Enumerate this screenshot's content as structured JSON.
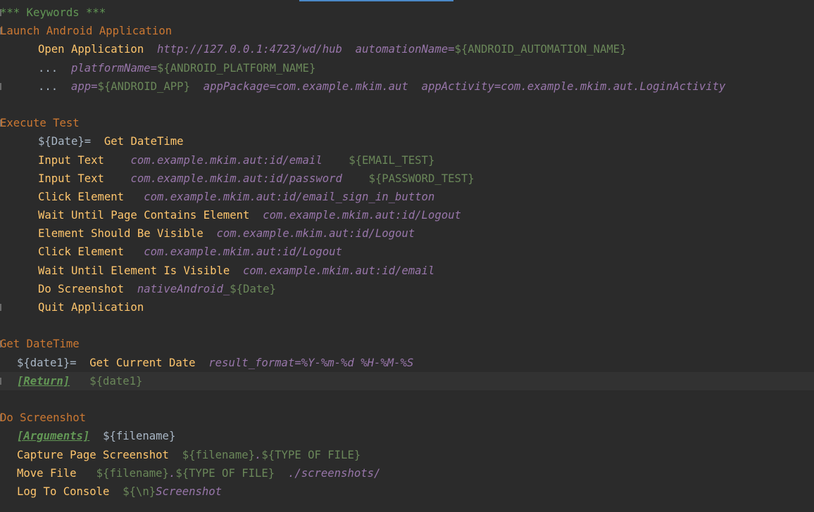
{
  "editor": {
    "lines": [
      {
        "indent": 0,
        "fold": true,
        "tokens": [
          {
            "c": "hdr",
            "t": "*** Keywords ***"
          }
        ]
      },
      {
        "indent": 0,
        "fold": true,
        "tokens": [
          {
            "c": "kwname",
            "t": "Launch Android Application"
          }
        ]
      },
      {
        "indent": 54,
        "fold": false,
        "tokens": [
          {
            "c": "kw",
            "t": "Open Application"
          },
          {
            "c": "gap",
            "t": "  "
          },
          {
            "c": "arg",
            "t": "http://127.0.0.1:4723/wd/hub"
          },
          {
            "c": "gap",
            "t": "  "
          },
          {
            "c": "arg",
            "t": "automationName="
          },
          {
            "c": "varg",
            "t": "${ANDROID_AUTOMATION_NAME}"
          }
        ]
      },
      {
        "indent": 54,
        "fold": false,
        "tokens": [
          {
            "c": "plain",
            "t": "..."
          },
          {
            "c": "gap",
            "t": "  "
          },
          {
            "c": "arg",
            "t": "platformName="
          },
          {
            "c": "varg",
            "t": "${ANDROID_PLATFORM_NAME}"
          }
        ]
      },
      {
        "indent": 54,
        "fold": true,
        "tokens": [
          {
            "c": "plain",
            "t": "..."
          },
          {
            "c": "gap",
            "t": "  "
          },
          {
            "c": "arg",
            "t": "app="
          },
          {
            "c": "varg",
            "t": "${ANDROID_APP}"
          },
          {
            "c": "gap",
            "t": "  "
          },
          {
            "c": "arg",
            "t": "appPackage=com.example.mkim.aut"
          },
          {
            "c": "gap",
            "t": "  "
          },
          {
            "c": "arg",
            "t": "appActivity=com.example.mkim.aut.LoginActivity"
          }
        ]
      },
      {
        "indent": 0,
        "fold": false,
        "tokens": []
      },
      {
        "indent": 0,
        "fold": true,
        "tokens": [
          {
            "c": "kwname",
            "t": "Execute Test"
          }
        ]
      },
      {
        "indent": 54,
        "fold": false,
        "tokens": [
          {
            "c": "var",
            "t": "${Date}="
          },
          {
            "c": "gap",
            "t": "  "
          },
          {
            "c": "kw",
            "t": "Get DateTime"
          }
        ]
      },
      {
        "indent": 54,
        "fold": false,
        "tokens": [
          {
            "c": "kw",
            "t": "Input Text"
          },
          {
            "c": "gap",
            "t": "    "
          },
          {
            "c": "arg",
            "t": "com.example.mkim.aut:id/email"
          },
          {
            "c": "gap",
            "t": "    "
          },
          {
            "c": "varg",
            "t": "${EMAIL_TEST}"
          }
        ]
      },
      {
        "indent": 54,
        "fold": false,
        "tokens": [
          {
            "c": "kw",
            "t": "Input Text"
          },
          {
            "c": "gap",
            "t": "    "
          },
          {
            "c": "arg",
            "t": "com.example.mkim.aut:id/password"
          },
          {
            "c": "gap",
            "t": "    "
          },
          {
            "c": "varg",
            "t": "${PASSWORD_TEST}"
          }
        ]
      },
      {
        "indent": 54,
        "fold": false,
        "tokens": [
          {
            "c": "kw",
            "t": "Click Element"
          },
          {
            "c": "gap",
            "t": "   "
          },
          {
            "c": "arg",
            "t": "com.example.mkim.aut:id/email_sign_in_button"
          }
        ]
      },
      {
        "indent": 54,
        "fold": false,
        "tokens": [
          {
            "c": "kw",
            "t": "Wait Until Page Contains Element"
          },
          {
            "c": "gap",
            "t": "  "
          },
          {
            "c": "arg",
            "t": "com.example.mkim.aut:id/Logout"
          }
        ]
      },
      {
        "indent": 54,
        "fold": false,
        "tokens": [
          {
            "c": "kw",
            "t": "Element Should Be Visible"
          },
          {
            "c": "gap",
            "t": "  "
          },
          {
            "c": "arg",
            "t": "com.example.mkim.aut:id/Logout"
          }
        ]
      },
      {
        "indent": 54,
        "fold": false,
        "tokens": [
          {
            "c": "kw",
            "t": "Click Element"
          },
          {
            "c": "gap",
            "t": "   "
          },
          {
            "c": "arg",
            "t": "com.example.mkim.aut:id/Logout"
          }
        ]
      },
      {
        "indent": 54,
        "fold": false,
        "tokens": [
          {
            "c": "kw",
            "t": "Wait Until Element Is Visible"
          },
          {
            "c": "gap",
            "t": "  "
          },
          {
            "c": "arg",
            "t": "com.example.mkim.aut:id/email"
          }
        ]
      },
      {
        "indent": 54,
        "fold": false,
        "tokens": [
          {
            "c": "kw",
            "t": "Do Screenshot"
          },
          {
            "c": "gap",
            "t": "  "
          },
          {
            "c": "arg",
            "t": "nativeAndroid_"
          },
          {
            "c": "varg",
            "t": "${Date}"
          }
        ]
      },
      {
        "indent": 54,
        "fold": true,
        "tokens": [
          {
            "c": "kw",
            "t": "Quit Application"
          }
        ]
      },
      {
        "indent": 0,
        "fold": false,
        "tokens": []
      },
      {
        "indent": 0,
        "fold": true,
        "tokens": [
          {
            "c": "kwname",
            "t": "Get DateTime"
          }
        ]
      },
      {
        "indent": 24,
        "fold": false,
        "tokens": [
          {
            "c": "var",
            "t": "${date1}="
          },
          {
            "c": "gap",
            "t": "  "
          },
          {
            "c": "kw",
            "t": "Get Current Date"
          },
          {
            "c": "gap",
            "t": "  "
          },
          {
            "c": "arg",
            "t": "result_format=%Y-%m-%d %H-%M-%S"
          }
        ]
      },
      {
        "indent": 24,
        "fold": true,
        "current": true,
        "tokens": [
          {
            "c": "setting",
            "t": "[Return]"
          },
          {
            "c": "gap",
            "t": "   "
          },
          {
            "c": "varg",
            "t": "${date1}"
          }
        ]
      },
      {
        "indent": 0,
        "fold": false,
        "tokens": []
      },
      {
        "indent": 0,
        "fold": true,
        "tokens": [
          {
            "c": "kwname",
            "t": "Do Screenshot"
          }
        ]
      },
      {
        "indent": 24,
        "fold": false,
        "tokens": [
          {
            "c": "setting",
            "t": "[Arguments]"
          },
          {
            "c": "gap",
            "t": "  "
          },
          {
            "c": "var",
            "t": "${filename}"
          }
        ]
      },
      {
        "indent": 24,
        "fold": false,
        "tokens": [
          {
            "c": "kw",
            "t": "Capture Page Screenshot"
          },
          {
            "c": "gap",
            "t": "  "
          },
          {
            "c": "varg",
            "t": "${filename}"
          },
          {
            "c": "arg",
            "t": "."
          },
          {
            "c": "varg",
            "t": "${TYPE OF FILE}"
          }
        ]
      },
      {
        "indent": 24,
        "fold": false,
        "tokens": [
          {
            "c": "kw",
            "t": "Move File"
          },
          {
            "c": "gap",
            "t": "   "
          },
          {
            "c": "varg",
            "t": "${filename}"
          },
          {
            "c": "arg",
            "t": "."
          },
          {
            "c": "varg",
            "t": "${TYPE OF FILE}"
          },
          {
            "c": "gap",
            "t": "  "
          },
          {
            "c": "arg",
            "t": "./screenshots/"
          }
        ]
      },
      {
        "indent": 24,
        "fold": false,
        "tokens": [
          {
            "c": "kw",
            "t": "Log To Console"
          },
          {
            "c": "gap",
            "t": "  "
          },
          {
            "c": "varg",
            "t": "${\\n}"
          },
          {
            "c": "arg",
            "t": "Screenshot"
          }
        ]
      }
    ]
  }
}
